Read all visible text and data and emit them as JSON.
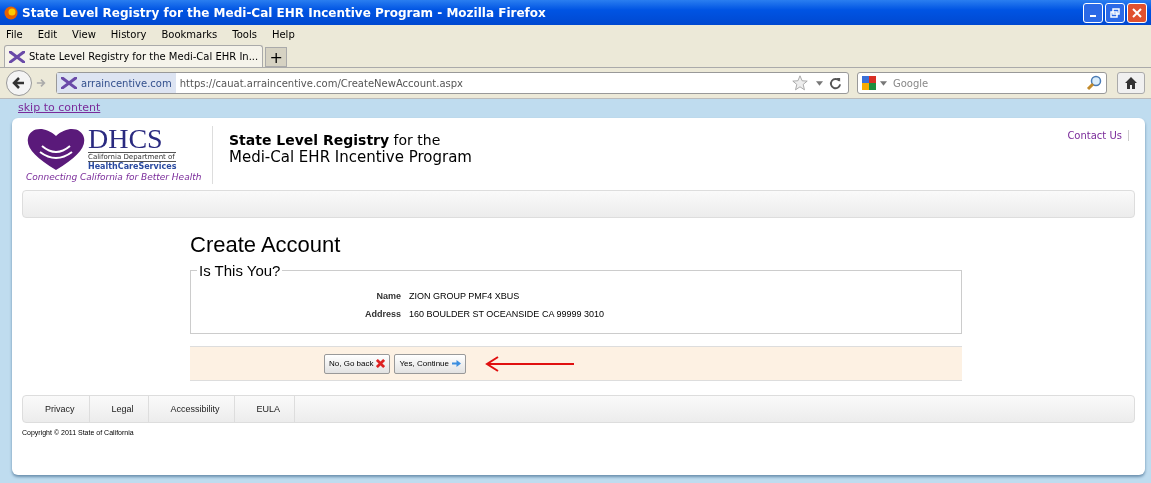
{
  "window": {
    "title": "State Level Registry for the Medi-Cal EHR Incentive Program - Mozilla Firefox"
  },
  "menu": [
    "File",
    "Edit",
    "View",
    "History",
    "Bookmarks",
    "Tools",
    "Help"
  ],
  "tabs": [
    {
      "label": "State Level Registry for the Medi-Cal EHR In...",
      "selected": true
    }
  ],
  "new_tab": "+",
  "address_bar": {
    "site_identity": "arraincentive.com",
    "url": "https://cauat.arraincentive.com/CreateNewAccount.aspx"
  },
  "search": {
    "placeholder": "Google"
  },
  "skip_link": "skip to content",
  "header": {
    "logo": {
      "letters": "DHCS",
      "department": "California Department of",
      "services": "HealthCareServices",
      "tagline": "Connecting California for Better Health"
    },
    "title_line_1": "**State Level Registry** for the",
    "title_line_2": "Medi-Cal EHR Incentive Program",
    "contact_link": "Contact Us"
  },
  "page_title": "Create Account",
  "fieldset": {
    "legend": "Is This You?",
    "fields": [
      {
        "label": "Name",
        "value": "ZION GROUP PMF4 XBUS"
      },
      {
        "label": "Address",
        "value": "160 BOULDER ST OCEANSIDE CA 99999 3010"
      }
    ]
  },
  "buttons": [
    {
      "label": "No, Go back",
      "kind": "back"
    },
    {
      "label": "Yes, Continue",
      "kind": "continue"
    }
  ],
  "footer": {
    "links": [
      "Privacy",
      "Legal",
      "Accessibility",
      "EULA"
    ],
    "copyright": "Copyright © 2011 State of California"
  }
}
